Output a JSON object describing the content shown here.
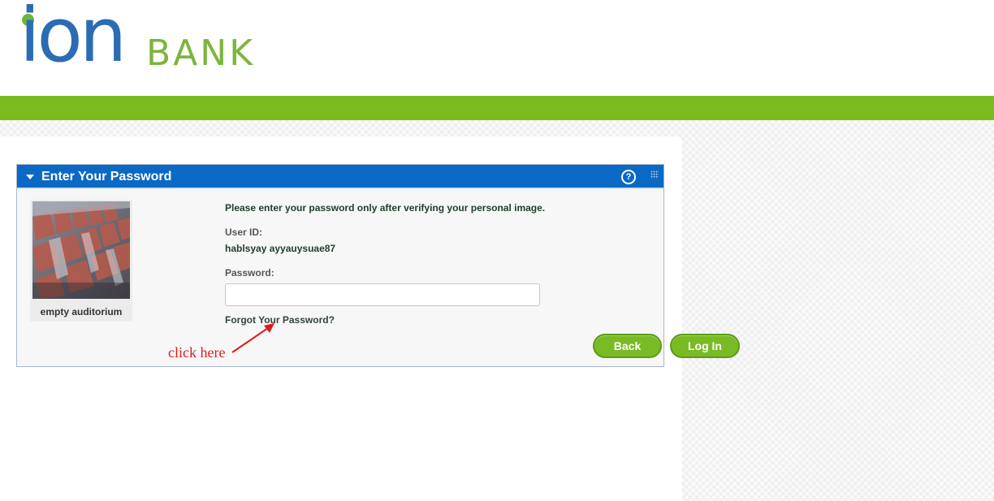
{
  "brand": {
    "logo_ion": "ion",
    "logo_bank": "BANK"
  },
  "panel": {
    "title": "Enter Your Password",
    "help_icon": "help-circle-icon",
    "grip_icon": "drag-grip-icon",
    "collapse_icon": "caret-down-icon"
  },
  "personal_image": {
    "caption": "empty auditorium"
  },
  "form": {
    "instruction": "Please enter your password only after verifying your personal image.",
    "userid_label": "User ID:",
    "userid_value": "hablsyay ayyauysuae87",
    "password_label": "Password:",
    "password_value": "",
    "forgot_link": "Forgot Your Password?",
    "back_button": "Back",
    "login_button": "Log In"
  },
  "annotation": {
    "text": "click here"
  },
  "colors": {
    "brand_blue": "#2b6cb4",
    "brand_green": "#7cb53d",
    "green_bar": "#7abc1f",
    "panel_header": "#0a69c4",
    "button_green": "#79bb25",
    "annotation_red": "#e01a1a"
  }
}
